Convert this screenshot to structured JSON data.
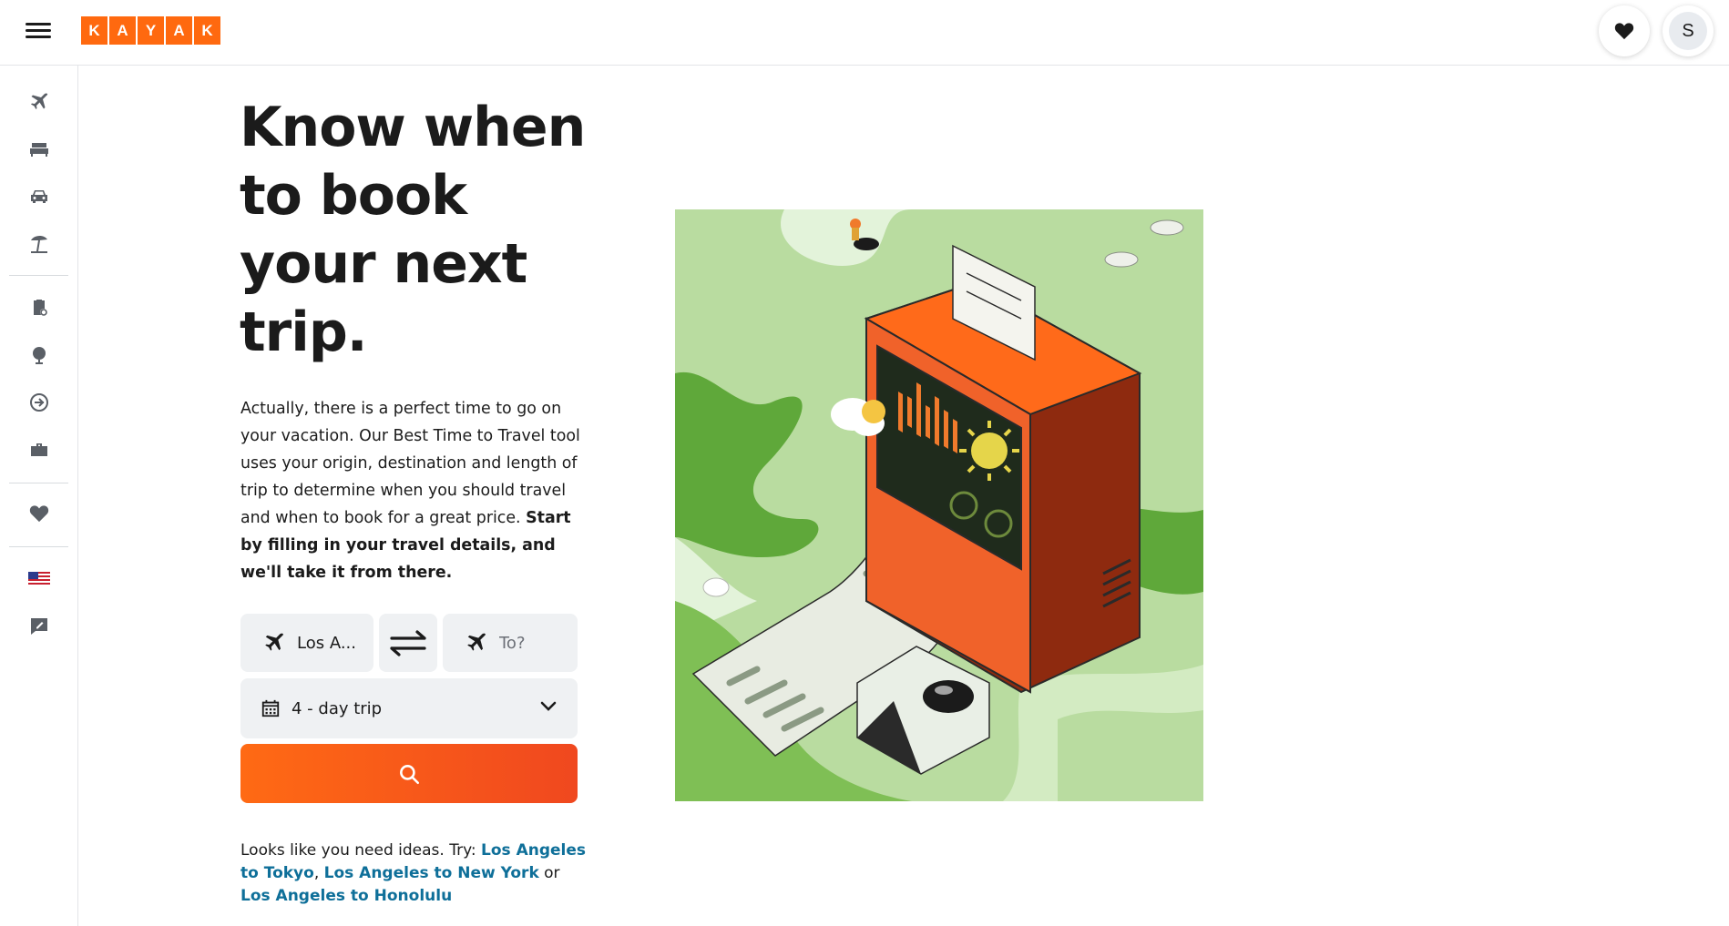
{
  "brand": {
    "letters": [
      "K",
      "A",
      "Y",
      "A",
      "K"
    ],
    "color": "#ff690f"
  },
  "header": {
    "menu_icon": "hamburger-icon",
    "favorites_icon": "heart-icon",
    "user_initial": "S"
  },
  "rail": {
    "items": [
      {
        "icon": "flight-icon"
      },
      {
        "icon": "hotel-icon"
      },
      {
        "icon": "car-icon"
      },
      {
        "icon": "beach-umbrella-icon"
      },
      {
        "icon": "clipboard-icon"
      },
      {
        "icon": "globe-icon"
      },
      {
        "icon": "flight-tracker-icon"
      },
      {
        "icon": "briefcase-icon"
      },
      {
        "icon": "heart-icon"
      },
      {
        "icon": "us-flag-icon"
      },
      {
        "icon": "feedback-icon"
      }
    ]
  },
  "hero": {
    "headline_lines": [
      "Know when",
      "to book",
      "your next",
      "trip."
    ],
    "intro_text": "Actually, there is a perfect time to go on your vacation. Our Best Time to Travel tool uses your origin, destination and length of trip to determine when you should travel and when to book for a great price.",
    "intro_bold": "Start by filling in your travel details, and we'll take it from there."
  },
  "search": {
    "origin_value": "Los A...",
    "destination_placeholder": "To?",
    "trip_length": "4 - day trip",
    "search_icon": "search-icon",
    "button_color": "#ff6a14"
  },
  "ideas": {
    "prefix": "Looks like you need ideas. Try:",
    "link1": "Los Angeles to Tokyo",
    "sep1": ",",
    "link2": "Los Angeles to New York",
    "sep2": "or",
    "link3": "Los Angeles to Honolulu",
    "link_color": "#0e6f99"
  }
}
